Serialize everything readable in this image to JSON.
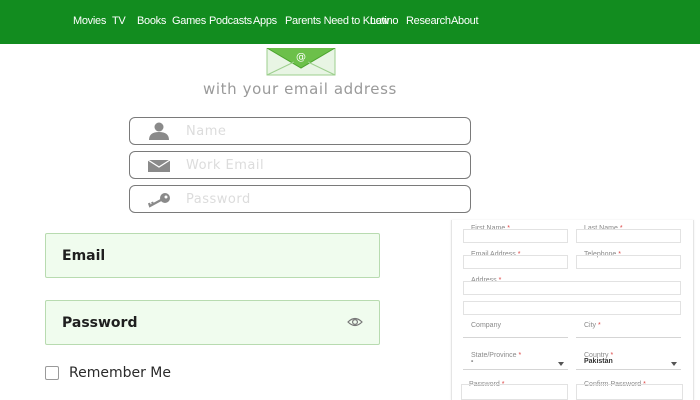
{
  "nav": {
    "items": [
      "Movies",
      "TV",
      "Books",
      "Games",
      "Podcasts",
      "Apps",
      "Parents Need to Know",
      "Latino",
      "Research",
      "About"
    ],
    "color": "#128c1f"
  },
  "signup": {
    "tagline": "with your email address",
    "name_placeholder": "Name",
    "email_placeholder": "Work Email",
    "password_placeholder": "Password",
    "icons": [
      "person-icon",
      "envelope-icon",
      "key-icon"
    ]
  },
  "login": {
    "email_label": "Email",
    "password_label": "Password",
    "remember_label": "Remember Me"
  },
  "form": {
    "first_name": "First Name",
    "last_name": "Last Name",
    "email_address": "Email Address",
    "telephone": "Telephone",
    "address": "Address",
    "company": "Company",
    "city": "City",
    "state": "State/Province",
    "state_value": "-",
    "country": "Country",
    "country_value": "Pakistan",
    "password": "Password",
    "confirm_password": "Confirm Password",
    "required_mark": "*"
  }
}
